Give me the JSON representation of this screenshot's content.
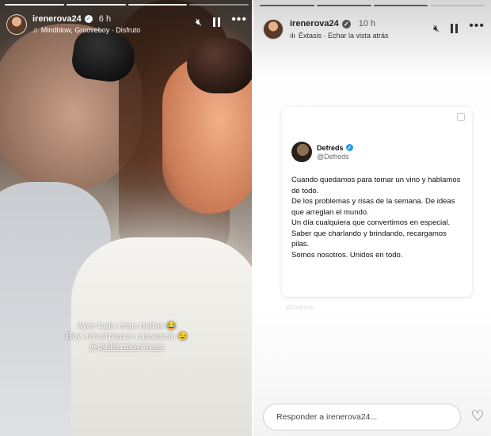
{
  "left_story": {
    "progress_bars": [
      true,
      true,
      true,
      false
    ],
    "username": "irenerova24",
    "time": "6 h",
    "music": "Mindblow, Grooveboy · Disfruto",
    "caption_line1": "Ayer todo eran risitas 😂",
    "caption_line2": "Hoy arrastramos cansancio 😉",
    "caption_mention": "@guillermovgreen",
    "icons": {
      "mute": "mute-icon",
      "pause": "pause-icon",
      "more": "more-icon",
      "verified": "verified-icon",
      "music": "music-icon"
    }
  },
  "right_story": {
    "progress_bars": [
      true,
      true,
      true,
      false
    ],
    "username": "irenerova24",
    "time": "10 h",
    "music": "Éxtasis · Echar la vista atrás",
    "tweet": {
      "name": "Defreds",
      "handle": "@Defreds",
      "lines": [
        "Cuando quedamos para tomar un vino y hablamos de todo.",
        "De los problemas y risas de la semana. De ideas que arreglan el mundo.",
        "Un día cualquiera que convertimos en especial.",
        "Saber que charlando y brindando, recargamos pilas.",
        "Somos nosotros. Unidos en todo."
      ],
      "footer": "@Defreds"
    },
    "reply_placeholder": "Responder a irenerova24...",
    "icons": {
      "mute": "mute-icon",
      "pause": "pause-icon",
      "more": "more-icon",
      "heart": "heart-icon"
    }
  },
  "colors": {
    "verified_blue": "#1d9bf0",
    "text_dark": "#111111"
  }
}
